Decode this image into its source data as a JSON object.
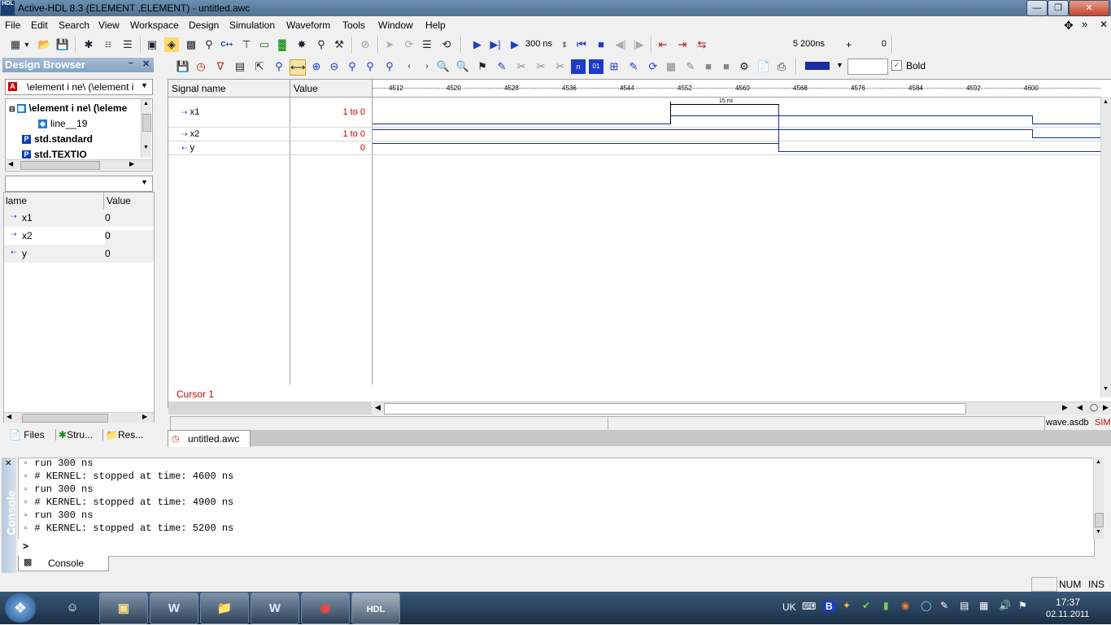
{
  "window": {
    "title": "Active-HDL 8.3 (ELEMENT ,ELEMENT) - untitled.awc",
    "app_icon_text": "HDL"
  },
  "menu": [
    "File",
    "Edit",
    "Search",
    "View",
    "Workspace",
    "Design",
    "Simulation",
    "Waveform",
    "Tools",
    "Window",
    "Help"
  ],
  "toolbar": {
    "run_time": "300 ns",
    "sim_time": "5 200ns",
    "plus": "+",
    "offset": "0",
    "bold_label": "Bold",
    "bold_checked": true
  },
  "design_browser": {
    "title": "Design Browser",
    "combo": "\\element i ne\\ (\\element i",
    "tree": [
      "\\element i ne\\ (\\eleme",
      "line__19",
      "std.standard",
      "std.TEXTIO"
    ],
    "columns": {
      "name": "lame",
      "value": "Value"
    },
    "signals": [
      {
        "name": "x1",
        "value": "0"
      },
      {
        "name": "x2",
        "value": "0"
      },
      {
        "name": "y",
        "value": "0"
      }
    ],
    "tabs": [
      "Files",
      "Stru...",
      "Res..."
    ]
  },
  "waveform": {
    "headers": {
      "signal": "Signal name",
      "value": "Value"
    },
    "rows": [
      {
        "name": "x1",
        "value": "1 to 0"
      },
      {
        "name": "x2",
        "value": "1 to 0"
      },
      {
        "name": "y",
        "value": "0"
      }
    ],
    "ticks": [
      "4512",
      "4520",
      "4528",
      "4536",
      "4544",
      "4552",
      "4560",
      "4568",
      "4576",
      "4584",
      "4592",
      "4600"
    ],
    "measure_label": "15 ns",
    "cursor_label": "Cursor 1",
    "status_file": "wave.asdb",
    "status_mode": "SIM",
    "doc_tab": "untitled.awc",
    "line_color": "#1a2d9a"
  },
  "console": {
    "side_label": "Console",
    "lines": [
      "run 300 ns",
      "# KERNEL: stopped at time: 4600 ns",
      "run 300 ns",
      "# KERNEL: stopped at time: 4900 ns",
      "run 300 ns",
      "# KERNEL: stopped at time: 5200 ns"
    ],
    "prompt": ">",
    "tab": "Console"
  },
  "statusbar": {
    "num": "NUM",
    "ins": "INS"
  },
  "taskbar": {
    "lang": "UK",
    "time": "17:37",
    "date": "02.11.2011",
    "active_app": "HDL"
  }
}
